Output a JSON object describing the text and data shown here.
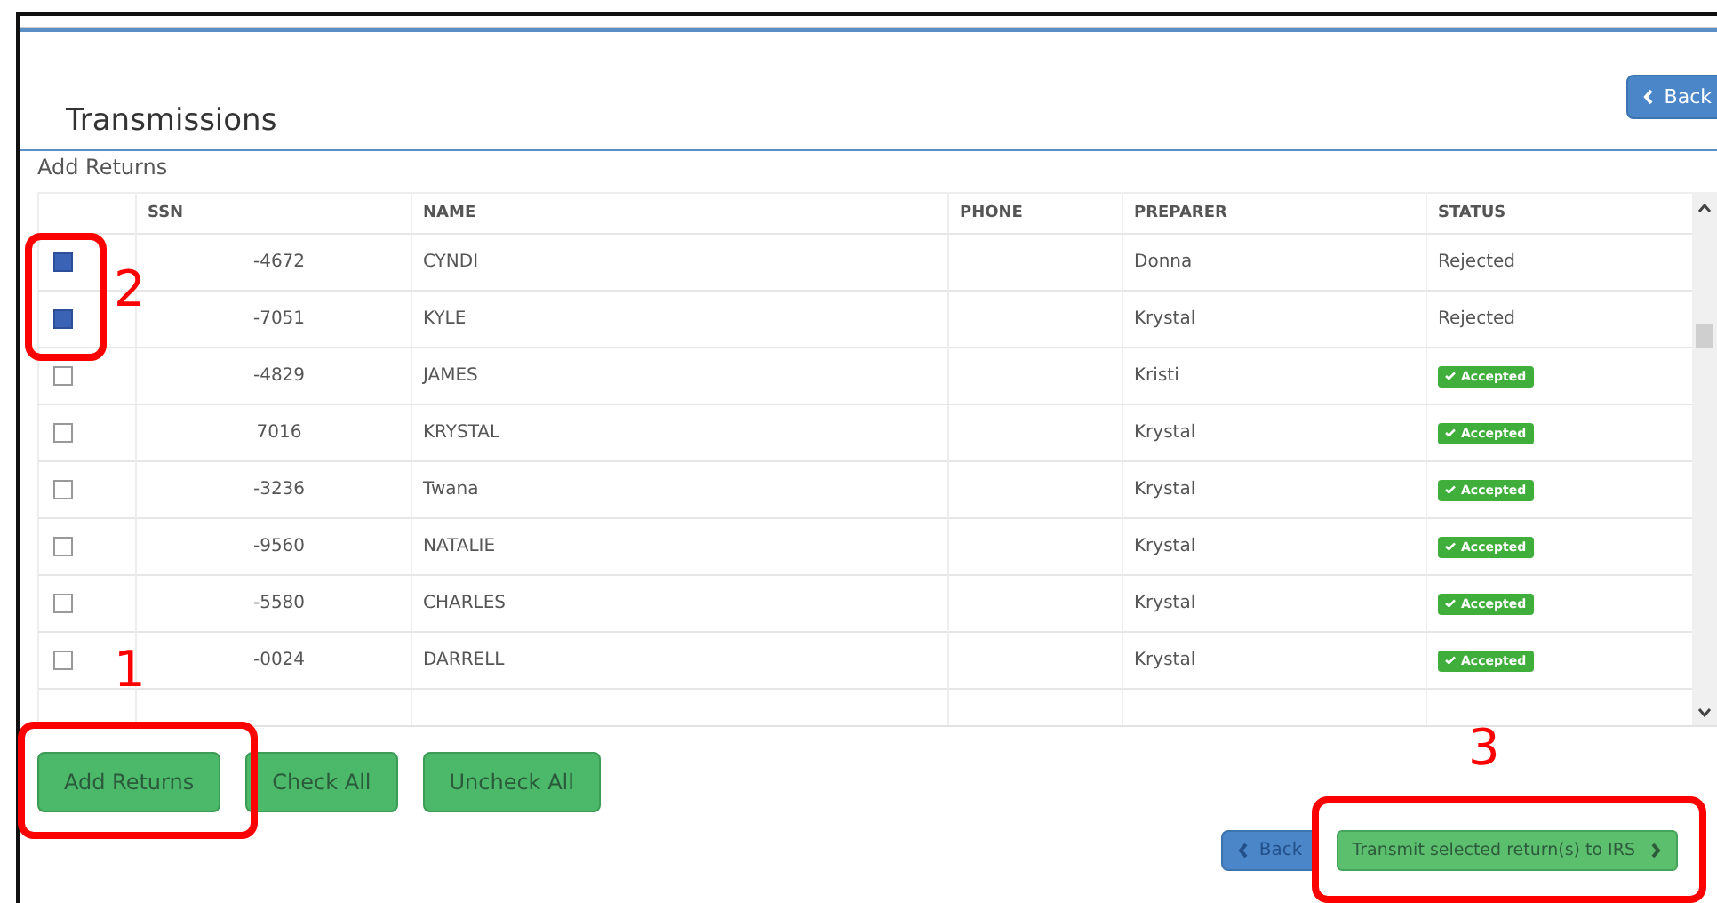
{
  "page": {
    "title": "Transmissions",
    "back_button": "Back"
  },
  "section": {
    "title": "Add Returns"
  },
  "table": {
    "columns": [
      "SSN",
      "NAME",
      "PHONE",
      "PREPARER",
      "STATUS"
    ],
    "rows": [
      {
        "checked": true,
        "ssn": "-4672",
        "name": "CYNDI",
        "preparer": "Donna",
        "status": {
          "kind": "plain",
          "text": "Rejected"
        }
      },
      {
        "checked": true,
        "ssn": "-7051",
        "name": "KYLE",
        "preparer": "Krystal",
        "status": {
          "kind": "plain",
          "text": "Rejected"
        }
      },
      {
        "checked": false,
        "ssn": "-4829",
        "name": "JAMES",
        "preparer": "Kristi",
        "status": {
          "kind": "badge",
          "text": "Accepted"
        }
      },
      {
        "checked": false,
        "ssn": "7016",
        "name": "KRYSTAL",
        "preparer": "Krystal",
        "status": {
          "kind": "badge",
          "text": "Accepted"
        }
      },
      {
        "checked": false,
        "ssn": "-3236",
        "name": "Twana",
        "preparer": "Krystal",
        "status": {
          "kind": "badge",
          "text": "Accepted"
        }
      },
      {
        "checked": false,
        "ssn": "-9560",
        "name": "NATALIE",
        "preparer": "Krystal",
        "status": {
          "kind": "badge",
          "text": "Accepted"
        }
      },
      {
        "checked": false,
        "ssn": "-5580",
        "name": "CHARLES",
        "preparer": "Krystal",
        "status": {
          "kind": "badge",
          "text": "Accepted"
        }
      },
      {
        "checked": false,
        "ssn": "-0024",
        "name": "DARRELL",
        "preparer": "Krystal",
        "status": {
          "kind": "badge",
          "text": "Accepted"
        }
      }
    ]
  },
  "actions": [
    "Add Returns",
    "Check All",
    "Uncheck All"
  ],
  "footer": {
    "back_button": "Back",
    "transmit_button": "Transmit selected return(s) to IRS"
  },
  "callouts": [
    {
      "label": "2",
      "kind": "checkboxes"
    },
    {
      "label": "1",
      "kind": "add"
    },
    {
      "label": "3",
      "kind": "transmit"
    }
  ]
}
